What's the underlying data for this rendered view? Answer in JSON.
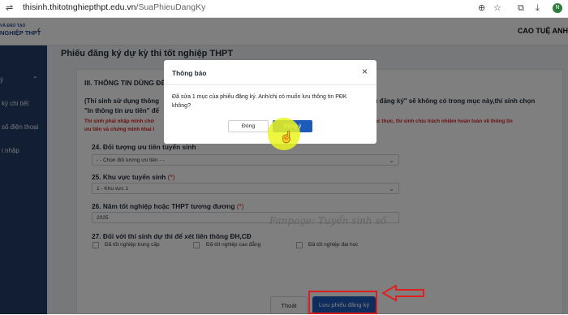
{
  "browser": {
    "url_host": "thisinh.thitotnghiepthpt.edu.vn",
    "url_path": "/SuaPhieuDangKy"
  },
  "header": {
    "logo_line1": "VÀ ĐÀO TẠO",
    "logo_line2": "NGHIỆP THPT",
    "user_name": "CAO TUỆ ANH"
  },
  "sidebar": {
    "items": [
      {
        "label": "ý"
      },
      {
        "label": "ký chi tiết"
      },
      {
        "label": "số điện thoại"
      },
      {
        "label": "i nhập"
      }
    ]
  },
  "page": {
    "title": "Phiếu đăng ký dự kỳ thi tốt nghiệp THPT",
    "section_title": "III. THÔNG TIN DÙNG ĐỂ",
    "info_line1_left": "(Thí sinh sử dụng thông",
    "info_line1_right": "phiếu đăng ký\" sẽ không có trong mục này,thí sinh chọn",
    "info_line2": "\"In thông tin ưu tiên\" để",
    "warn_left1": "Thí sinh phải nhập minh chứ",
    "warn_right1": "n tra và xác thực, thí sinh chịu trách nhiệm hoàn toàn về thông tin",
    "warn_left2": "ưu tiên và chứng minh khai l",
    "watermark": "Fanpage: Tuyển sinh số"
  },
  "form": {
    "q24": {
      "label": "24. Đối tượng ưu tiên tuyển sinh",
      "value": "- - Chọn đối tượng ưu tiên - -"
    },
    "q25": {
      "label": "25. Khu vực tuyển sinh",
      "required": "(*)",
      "value": "1 - Khu vực 1"
    },
    "q26": {
      "label": "26. Năm tốt nghiệp hoặc THPT tương đương",
      "required": "(*)",
      "value": "2025"
    },
    "q27": {
      "label": "27. Đối với thí sinh dự thi để xét liên thông ĐH,CĐ",
      "options": [
        "Đã tốt nghiệp trung cấp",
        "Đã tốt nghiệp cao đẳng",
        "Đã tốt nghiệp đại học"
      ]
    }
  },
  "actions": {
    "exit_label": "Thoát",
    "save_label": "Lưu phiếu đăng ký"
  },
  "dialog": {
    "title": "Thông báo",
    "message": "Đã sửa 1 mục của phiếu đăng ký. Anh/chị có muốn lưu thông tin PĐK không?",
    "cancel_label": "Đóng",
    "confirm_label": "Đồng ý"
  },
  "colors": {
    "sidebar": "#233c67",
    "primary": "#1e5bb8",
    "warning": "#d42020",
    "highlight": "#ebf51e"
  }
}
